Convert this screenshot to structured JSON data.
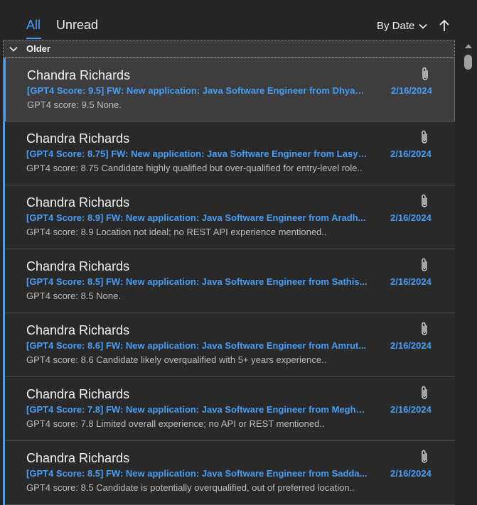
{
  "filters": {
    "all": "All",
    "unread": "Unread"
  },
  "sort": {
    "label": "By Date"
  },
  "group": {
    "label": "Older"
  },
  "messages": [
    {
      "sender": "Chandra Richards",
      "subject": "[GPT4 Score: 9.5] FW: New application: Java Software Engineer from Dhyan...",
      "date": "2/16/2024",
      "preview": "GPT4 score: 9.5 None."
    },
    {
      "sender": "Chandra Richards",
      "subject": "[GPT4 Score: 8.75] FW: New application: Java Software Engineer from Lasya...",
      "date": "2/16/2024",
      "preview": "GPT4 score: 8.75 Candidate highly qualified but over-qualified for entry-level role.."
    },
    {
      "sender": "Chandra Richards",
      "subject": "[GPT4 Score: 8.9] FW: New application: Java Software Engineer from Aradh...",
      "date": "2/16/2024",
      "preview": "GPT4 score: 8.9 Location not ideal; no REST API experience mentioned.."
    },
    {
      "sender": "Chandra Richards",
      "subject": "[GPT4 Score: 8.5] FW: New application: Java Software Engineer from Sathis...",
      "date": "2/16/2024",
      "preview": "GPT4 score: 8.5 None."
    },
    {
      "sender": "Chandra Richards",
      "subject": "[GPT4 Score: 8.6] FW: New application: Java Software Engineer from Amrut...",
      "date": "2/16/2024",
      "preview": "GPT4 score: 8.6 Candidate likely overqualified with 5+ years experience.."
    },
    {
      "sender": "Chandra Richards",
      "subject": "[GPT4 Score: 7.8] FW: New application: Java Software Engineer from Megha...",
      "date": "2/16/2024",
      "preview": "GPT4 score: 7.8 Limited overall experience; no API or REST mentioned.."
    },
    {
      "sender": "Chandra Richards",
      "subject": "[GPT4 Score: 8.5] FW: New application: Java Software Engineer from Sadda...",
      "date": "2/16/2024",
      "preview": "GPT4 score: 8.5 Candidate is potentially overqualified, out of preferred location.."
    }
  ],
  "icons": {
    "attachment": "paperclip-icon",
    "sort_dropdown": "chevron-down-icon",
    "sort_direction": "arrow-up-icon",
    "group_toggle": "chevron-down-icon"
  },
  "colors": {
    "accent": "#479ef5",
    "background": "#262626"
  }
}
